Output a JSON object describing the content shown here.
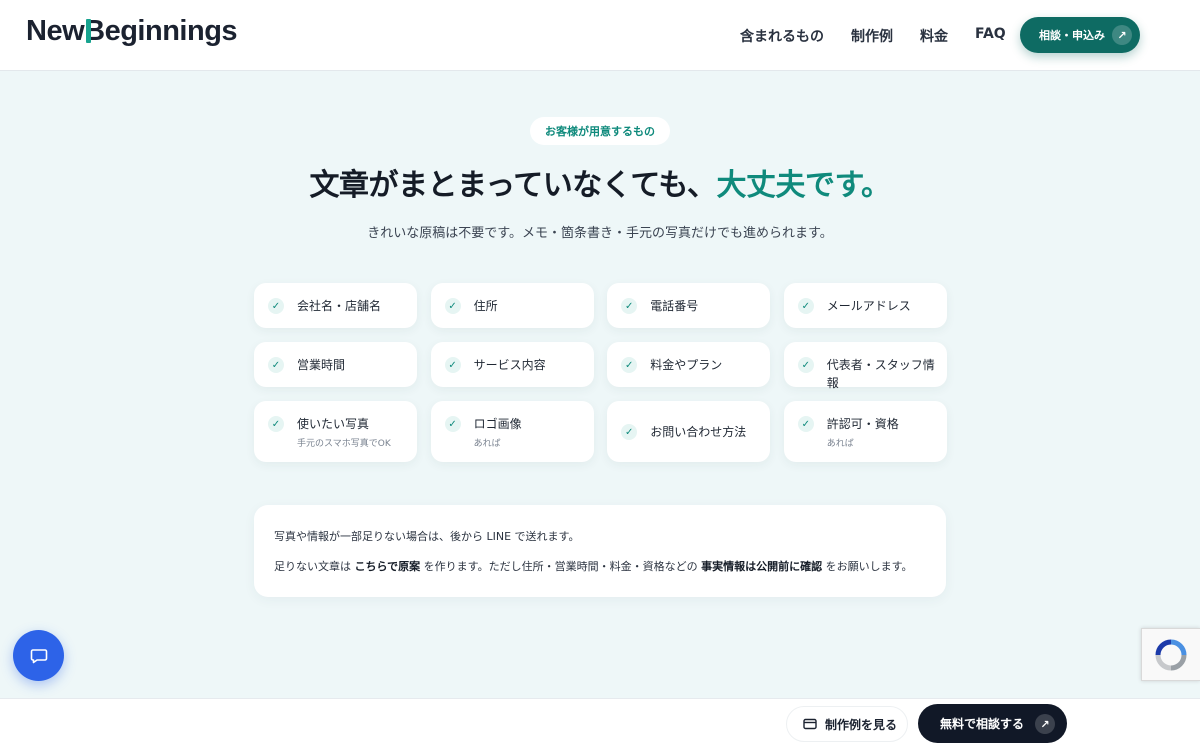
{
  "header": {
    "logo_pre": "New",
    "logo_b": "B",
    "logo_post": "eginnings",
    "nav": [
      "含まれるもの",
      "制作例",
      "料金",
      "FAQ"
    ],
    "cta_label": "相談・申込み"
  },
  "section": {
    "pill": "お客様が用意するもの",
    "heading_main": "文章がまとまっていなくても、",
    "heading_accent": "大丈夫です。",
    "subtext": "きれいな原稿は不要です。メモ・箇条書き・手元の写真だけでも進められます。"
  },
  "items": [
    {
      "label": "会社名・店舗名",
      "note": ""
    },
    {
      "label": "住所",
      "note": ""
    },
    {
      "label": "電話番号",
      "note": ""
    },
    {
      "label": "メールアドレス",
      "note": ""
    },
    {
      "label": "営業時間",
      "note": ""
    },
    {
      "label": "サービス内容",
      "note": ""
    },
    {
      "label": "料金やプラン",
      "note": ""
    },
    {
      "label": "代表者・スタッフ情報",
      "note": ""
    },
    {
      "label": "使いたい写真",
      "note": "手元のスマホ写真でOK"
    },
    {
      "label": "ロゴ画像",
      "note": "あれば"
    },
    {
      "label": "お問い合わせ方法",
      "note": ""
    },
    {
      "label": "許認可・資格",
      "note": "あれば"
    }
  ],
  "notice": {
    "line1": "写真や情報が一部足りない場合は、後から LINE で送れます。",
    "line2_a": "足りない文章は ",
    "line2_b": "こちらで原案",
    "line2_c": " を作ります。ただし住所・営業時間・料金・資格などの ",
    "line2_d": "事実情報は公開前に確認",
    "line2_e": " をお願いします。"
  },
  "bottom": {
    "works_label": "制作例を見る",
    "free_label": "無料で相談する"
  },
  "colors": {
    "accent": "#0f8a7c",
    "cta_top": "#0e6b63",
    "cta_bottom": "#111827",
    "chat": "#2d63e8",
    "background": "#eef7f8"
  },
  "icons": {
    "check": "check-icon",
    "arrow": "arrow-up-right-icon",
    "chat": "chat-bubble-icon",
    "card": "credit-card-icon",
    "recaptcha": "recaptcha-icon"
  }
}
